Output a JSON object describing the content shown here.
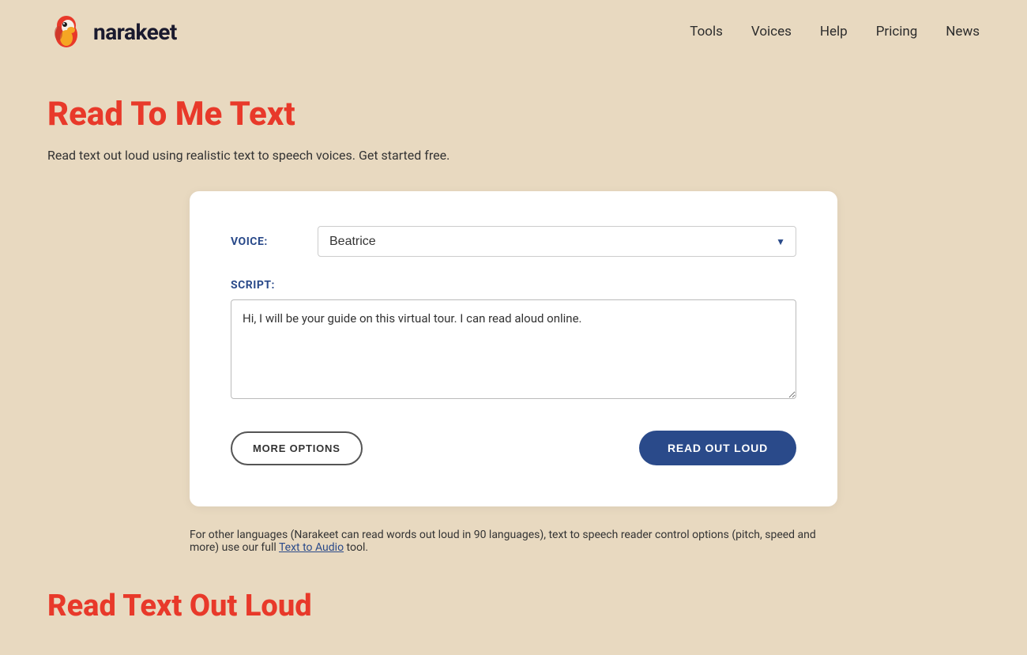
{
  "logo": {
    "text": "narakeet"
  },
  "nav": {
    "items": [
      {
        "label": "Tools",
        "href": "#"
      },
      {
        "label": "Voices",
        "href": "#"
      },
      {
        "label": "Help",
        "href": "#"
      },
      {
        "label": "Pricing",
        "href": "#"
      },
      {
        "label": "News",
        "href": "#"
      }
    ]
  },
  "hero": {
    "title": "Read To Me Text",
    "subtitle": "Read text out loud using realistic text to speech voices. Get started free."
  },
  "card": {
    "voice_label": "VOICE:",
    "voice_value": "Beatrice",
    "script_label": "SCRIPT:",
    "script_value": "Hi, I will be your guide on this virtual tour. I can read aloud online.",
    "more_options_label": "MORE OPTIONS",
    "read_out_loud_label": "READ OUT LOUD"
  },
  "footer_note": {
    "text_before": "For other languages (Narakeet can read words out loud in 90 languages), text to speech reader control options (pitch, speed and more) use our full ",
    "link_text": "Text to Audio",
    "text_after": " tool."
  },
  "section2": {
    "title": "Read Text Out Loud"
  }
}
